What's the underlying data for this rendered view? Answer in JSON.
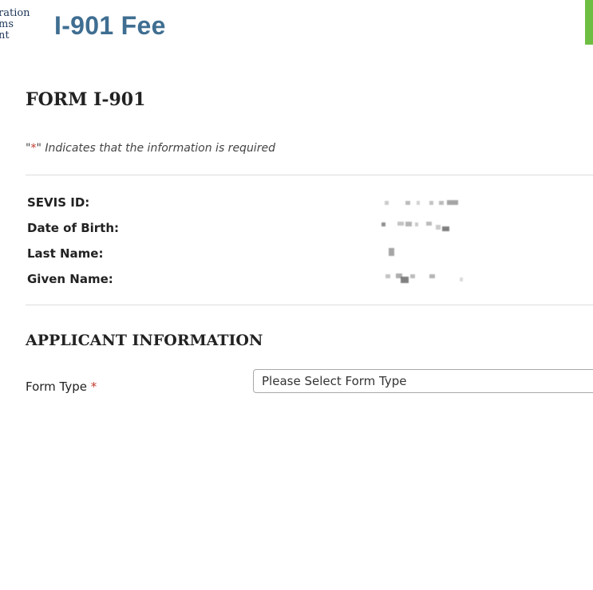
{
  "header": {
    "agency_logo_lines": [
      "ration",
      "ms",
      "nt"
    ],
    "site_title": "I-901 Fee",
    "accent_color": "#6fbe44",
    "title_color": "#3f6e91"
  },
  "form": {
    "title": "FORM I-901",
    "required_note_prefix": "\"",
    "required_note_star": "*",
    "required_note_suffix": "\" Indicates that the information is required"
  },
  "student_info": {
    "rows": [
      {
        "label": "SEVIS ID:",
        "value": "[redacted]"
      },
      {
        "label": "Date of Birth:",
        "value": "[redacted]"
      },
      {
        "label": "Last Name:",
        "value": "[redacted]"
      },
      {
        "label": "Given Name:",
        "value": "[redacted]"
      }
    ]
  },
  "applicant": {
    "section_title": "APPLICANT INFORMATION",
    "form_type_label": "Form Type",
    "required_star": "*",
    "form_type_selected": "Please Select Form Type"
  }
}
